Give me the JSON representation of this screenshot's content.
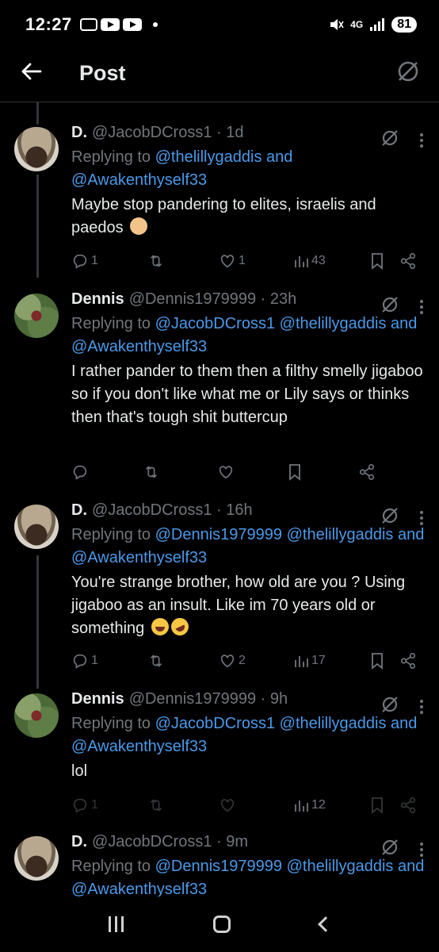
{
  "status_bar": {
    "time": "12:27",
    "network": "4G",
    "battery": "81"
  },
  "header": {
    "title": "Post"
  },
  "replies": [
    {
      "name": "D.",
      "handle": "@JacobDCross1 · 1d",
      "replying_prefix": "Replying to",
      "mentions": [
        "@thelillygaddis",
        "and",
        "@Awakenthyself33"
      ],
      "text": "Maybe stop pandering to elites, israelis and paedos",
      "stats": {
        "replies": "1",
        "likes": "1",
        "views": "43"
      }
    },
    {
      "name": "Dennis",
      "handle": "@Dennis1979999 · 23h",
      "replying_prefix": "Replying to",
      "mentions": [
        "@JacobDCross1",
        "@thelillygaddis",
        "and",
        "@Awakenthyself33"
      ],
      "text": "I rather pander to them then a filthy smelly jigaboo so if you don't like what me or Lily says or thinks then that's tough shit buttercup",
      "stats": {
        "replies": "",
        "likes": "",
        "views": ""
      }
    },
    {
      "name": "D.",
      "handle": "@JacobDCross1 · 16h",
      "replying_prefix": "Replying to",
      "mentions": [
        "@Dennis1979999",
        "@thelillygaddis",
        "and",
        "@Awakenthyself33"
      ],
      "text": "You're strange brother, how old are you ? Using jigaboo as an insult. Like im 70 years old or something",
      "stats": {
        "replies": "1",
        "likes": "2",
        "views": "17"
      }
    },
    {
      "name": "Dennis",
      "handle": "@Dennis1979999 · 9h",
      "replying_prefix": "Replying to",
      "mentions": [
        "@JacobDCross1",
        "@thelillygaddis",
        "and",
        "@Awakenthyself33"
      ],
      "text": "lol",
      "stats": {
        "replies": "1",
        "likes": "",
        "views": "12"
      }
    },
    {
      "name": "D.",
      "handle": "@JacobDCross1 · 9m",
      "replying_prefix": "Replying to",
      "mentions": [
        "@Dennis1979999",
        "@thelillygaddis",
        "and",
        "@Awakenthyself33"
      ],
      "text": "",
      "stats": {
        "replies": "",
        "likes": "",
        "views": ""
      }
    }
  ],
  "icons": {
    "back": "back-arrow-icon",
    "grok": "grok-icon",
    "more": "more-icon",
    "reply": "reply-icon",
    "retweet": "retweet-icon",
    "like": "heart-icon",
    "views": "views-icon",
    "bookmark": "bookmark-icon",
    "share": "share-icon"
  },
  "colors": {
    "background": "#000000",
    "text": "#e7e9ea",
    "muted": "#71767b",
    "link": "#4a99e9"
  }
}
